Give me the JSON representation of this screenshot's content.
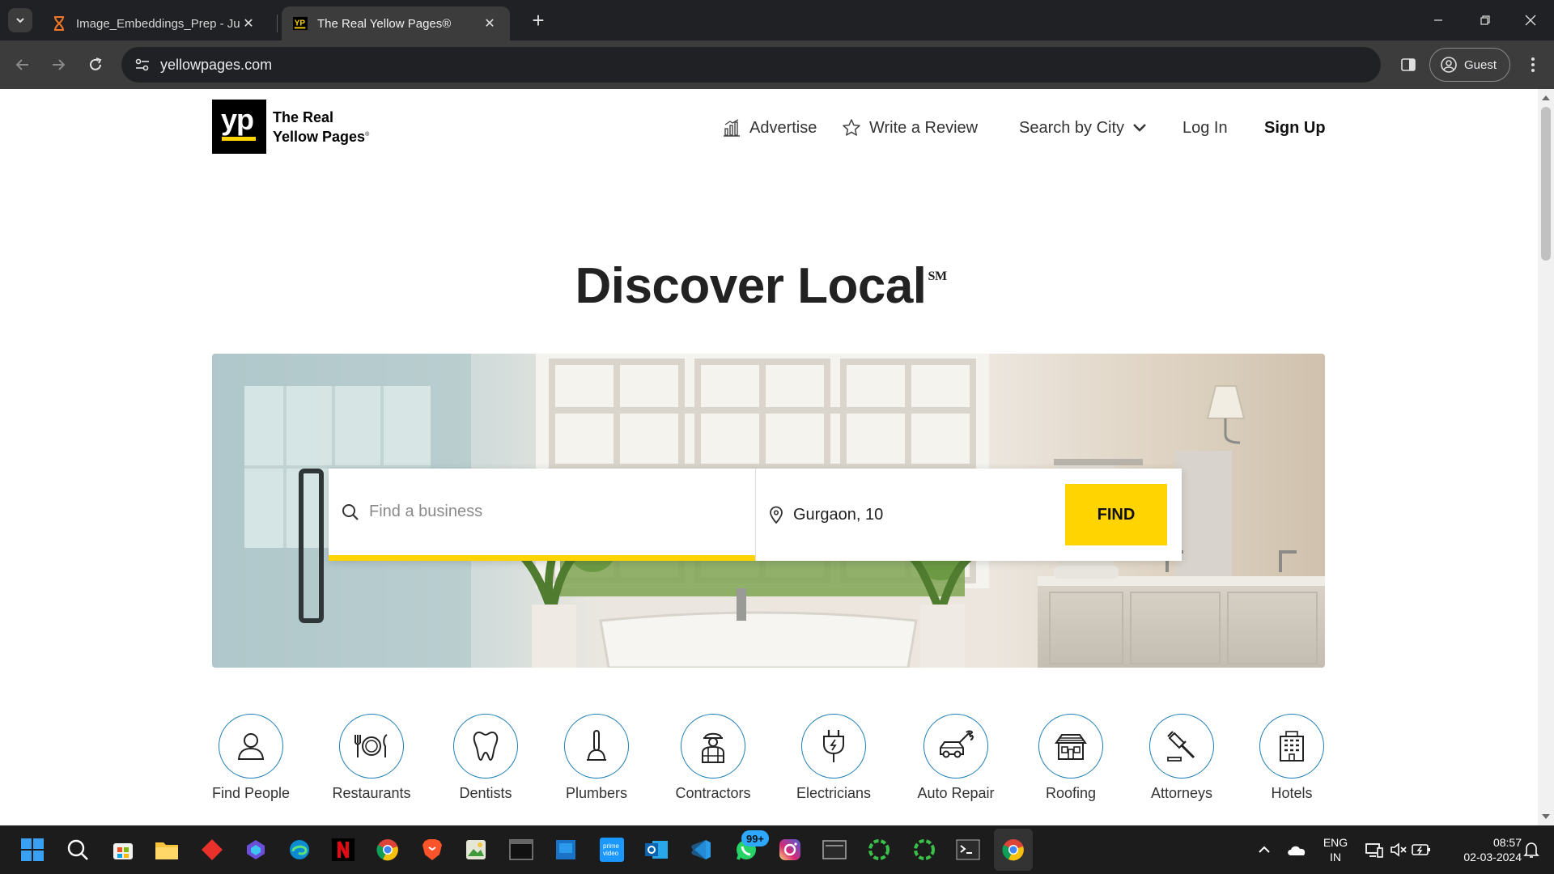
{
  "browser": {
    "tabs": [
      {
        "title": "Image_Embeddings_Prep - Jupy",
        "active": false,
        "icon": "jupyter-hourglass-icon"
      },
      {
        "title": "The Real Yellow Pages®",
        "active": true,
        "icon": "yp-favicon"
      }
    ],
    "url": "yellowpages.com",
    "profile_label": "Guest"
  },
  "page": {
    "logo": {
      "line1": "The Real",
      "line2": "Yellow Pages",
      "mark": "yp"
    },
    "nav": {
      "advertise": "Advertise",
      "write_review": "Write a Review",
      "search_by_city": "Search by City",
      "log_in": "Log In",
      "sign_up": "Sign Up"
    },
    "headline": "Discover Local",
    "headline_mark": "SM",
    "search": {
      "term_placeholder": "Find a business",
      "location_value": "Gurgaon, 10",
      "find_label": "FIND"
    },
    "categories": [
      {
        "label": "Find People",
        "icon": "person-icon"
      },
      {
        "label": "Restaurants",
        "icon": "plate-cutlery-icon"
      },
      {
        "label": "Dentists",
        "icon": "tooth-icon"
      },
      {
        "label": "Plumbers",
        "icon": "plunger-icon"
      },
      {
        "label": "Contractors",
        "icon": "worker-icon"
      },
      {
        "label": "Electricians",
        "icon": "plug-icon"
      },
      {
        "label": "Auto Repair",
        "icon": "car-wrench-icon"
      },
      {
        "label": "Roofing",
        "icon": "house-roof-icon"
      },
      {
        "label": "Attorneys",
        "icon": "gavel-icon"
      },
      {
        "label": "Hotels",
        "icon": "hotel-building-icon"
      }
    ]
  },
  "taskbar": {
    "whatsapp_badge": "99+",
    "language_line1": "ENG",
    "language_line2": "IN",
    "time": "08:57",
    "date": "02-03-2024"
  },
  "colors": {
    "brand_yellow": "#ffd400",
    "icon_ring_blue": "#1f7fb6",
    "chrome_dark": "#202124",
    "chrome_toolbar": "#3c3c3c"
  }
}
